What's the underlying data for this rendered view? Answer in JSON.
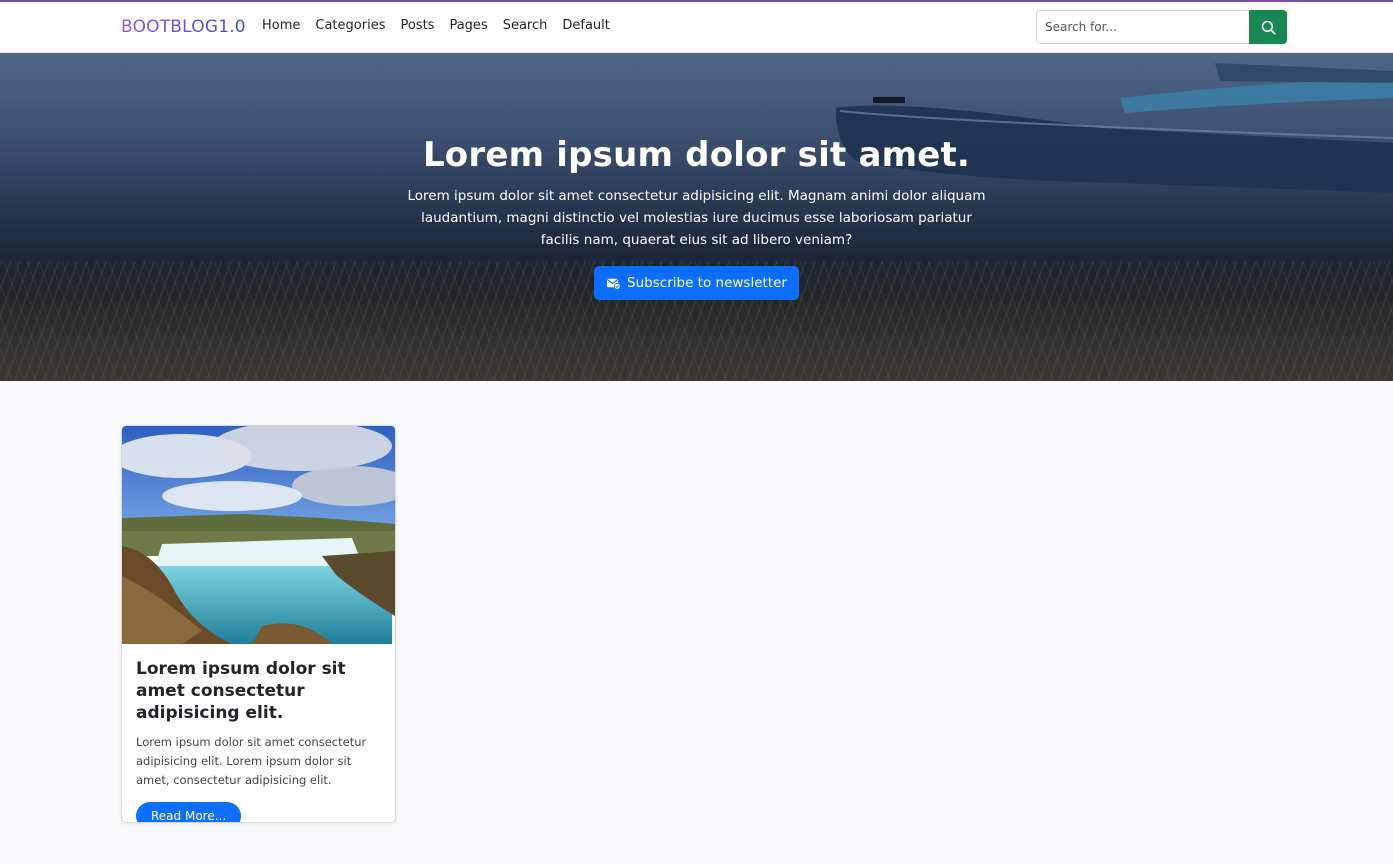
{
  "navbar": {
    "brand": "BOOTBLOG1.0",
    "links": [
      "Home",
      "Categories",
      "Posts",
      "Pages",
      "Search",
      "Default"
    ],
    "search_placeholder": "Search for..."
  },
  "hero": {
    "title": "Lorem ipsum dolor sit amet.",
    "text": "Lorem ipsum dolor sit amet consectetur adipisicing elit. Magnam animi dolor aliquam laudantium, magni distinctio vel molestias iure ducimus esse laboriosam pariatur facilis nam, quaerat eius sit ad libero veniam?",
    "button_label": "Subscribe to newsletter"
  },
  "posts": [
    {
      "title": "Lorem ipsum dolor sit amet consectetur adipisicing elit.",
      "text": "Lorem ipsum dolor sit amet consectetur adipisicing elit. Lorem ipsum dolor sit amet, consectetur adipisicing elit.",
      "button_label": "Read More..."
    }
  ],
  "colors": {
    "accent_line": "#7a4fb5",
    "search_button": "#198754",
    "primary": "#0d6efd",
    "page_bg": "#f8f9fa"
  }
}
